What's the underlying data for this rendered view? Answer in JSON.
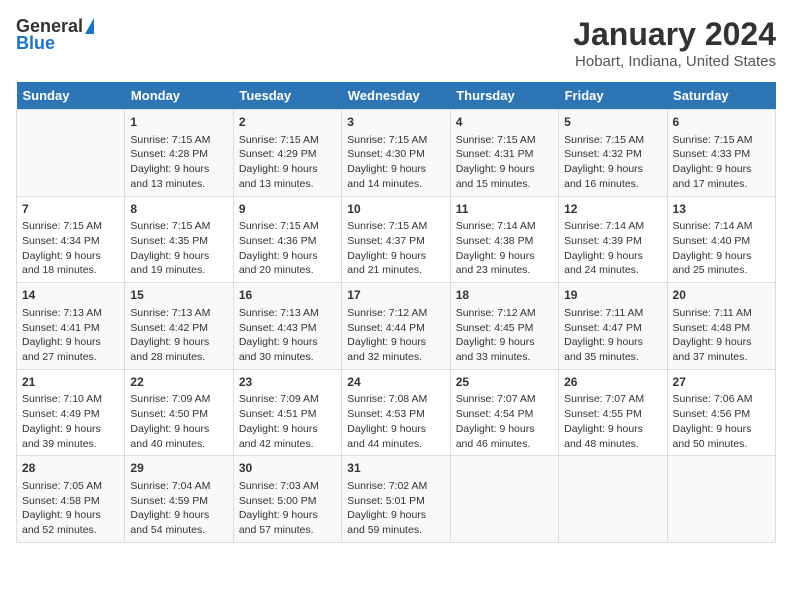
{
  "logo": {
    "general": "General",
    "blue": "Blue"
  },
  "title": "January 2024",
  "subtitle": "Hobart, Indiana, United States",
  "days_of_week": [
    "Sunday",
    "Monday",
    "Tuesday",
    "Wednesday",
    "Thursday",
    "Friday",
    "Saturday"
  ],
  "weeks": [
    [
      {
        "day": "",
        "info": ""
      },
      {
        "day": "1",
        "info": "Sunrise: 7:15 AM\nSunset: 4:28 PM\nDaylight: 9 hours and 13 minutes."
      },
      {
        "day": "2",
        "info": "Sunrise: 7:15 AM\nSunset: 4:29 PM\nDaylight: 9 hours and 13 minutes."
      },
      {
        "day": "3",
        "info": "Sunrise: 7:15 AM\nSunset: 4:30 PM\nDaylight: 9 hours and 14 minutes."
      },
      {
        "day": "4",
        "info": "Sunrise: 7:15 AM\nSunset: 4:31 PM\nDaylight: 9 hours and 15 minutes."
      },
      {
        "day": "5",
        "info": "Sunrise: 7:15 AM\nSunset: 4:32 PM\nDaylight: 9 hours and 16 minutes."
      },
      {
        "day": "6",
        "info": "Sunrise: 7:15 AM\nSunset: 4:33 PM\nDaylight: 9 hours and 17 minutes."
      }
    ],
    [
      {
        "day": "7",
        "info": "Sunrise: 7:15 AM\nSunset: 4:34 PM\nDaylight: 9 hours and 18 minutes."
      },
      {
        "day": "8",
        "info": "Sunrise: 7:15 AM\nSunset: 4:35 PM\nDaylight: 9 hours and 19 minutes."
      },
      {
        "day": "9",
        "info": "Sunrise: 7:15 AM\nSunset: 4:36 PM\nDaylight: 9 hours and 20 minutes."
      },
      {
        "day": "10",
        "info": "Sunrise: 7:15 AM\nSunset: 4:37 PM\nDaylight: 9 hours and 21 minutes."
      },
      {
        "day": "11",
        "info": "Sunrise: 7:14 AM\nSunset: 4:38 PM\nDaylight: 9 hours and 23 minutes."
      },
      {
        "day": "12",
        "info": "Sunrise: 7:14 AM\nSunset: 4:39 PM\nDaylight: 9 hours and 24 minutes."
      },
      {
        "day": "13",
        "info": "Sunrise: 7:14 AM\nSunset: 4:40 PM\nDaylight: 9 hours and 25 minutes."
      }
    ],
    [
      {
        "day": "14",
        "info": "Sunrise: 7:13 AM\nSunset: 4:41 PM\nDaylight: 9 hours and 27 minutes."
      },
      {
        "day": "15",
        "info": "Sunrise: 7:13 AM\nSunset: 4:42 PM\nDaylight: 9 hours and 28 minutes."
      },
      {
        "day": "16",
        "info": "Sunrise: 7:13 AM\nSunset: 4:43 PM\nDaylight: 9 hours and 30 minutes."
      },
      {
        "day": "17",
        "info": "Sunrise: 7:12 AM\nSunset: 4:44 PM\nDaylight: 9 hours and 32 minutes."
      },
      {
        "day": "18",
        "info": "Sunrise: 7:12 AM\nSunset: 4:45 PM\nDaylight: 9 hours and 33 minutes."
      },
      {
        "day": "19",
        "info": "Sunrise: 7:11 AM\nSunset: 4:47 PM\nDaylight: 9 hours and 35 minutes."
      },
      {
        "day": "20",
        "info": "Sunrise: 7:11 AM\nSunset: 4:48 PM\nDaylight: 9 hours and 37 minutes."
      }
    ],
    [
      {
        "day": "21",
        "info": "Sunrise: 7:10 AM\nSunset: 4:49 PM\nDaylight: 9 hours and 39 minutes."
      },
      {
        "day": "22",
        "info": "Sunrise: 7:09 AM\nSunset: 4:50 PM\nDaylight: 9 hours and 40 minutes."
      },
      {
        "day": "23",
        "info": "Sunrise: 7:09 AM\nSunset: 4:51 PM\nDaylight: 9 hours and 42 minutes."
      },
      {
        "day": "24",
        "info": "Sunrise: 7:08 AM\nSunset: 4:53 PM\nDaylight: 9 hours and 44 minutes."
      },
      {
        "day": "25",
        "info": "Sunrise: 7:07 AM\nSunset: 4:54 PM\nDaylight: 9 hours and 46 minutes."
      },
      {
        "day": "26",
        "info": "Sunrise: 7:07 AM\nSunset: 4:55 PM\nDaylight: 9 hours and 48 minutes."
      },
      {
        "day": "27",
        "info": "Sunrise: 7:06 AM\nSunset: 4:56 PM\nDaylight: 9 hours and 50 minutes."
      }
    ],
    [
      {
        "day": "28",
        "info": "Sunrise: 7:05 AM\nSunset: 4:58 PM\nDaylight: 9 hours and 52 minutes."
      },
      {
        "day": "29",
        "info": "Sunrise: 7:04 AM\nSunset: 4:59 PM\nDaylight: 9 hours and 54 minutes."
      },
      {
        "day": "30",
        "info": "Sunrise: 7:03 AM\nSunset: 5:00 PM\nDaylight: 9 hours and 57 minutes."
      },
      {
        "day": "31",
        "info": "Sunrise: 7:02 AM\nSunset: 5:01 PM\nDaylight: 9 hours and 59 minutes."
      },
      {
        "day": "",
        "info": ""
      },
      {
        "day": "",
        "info": ""
      },
      {
        "day": "",
        "info": ""
      }
    ]
  ]
}
